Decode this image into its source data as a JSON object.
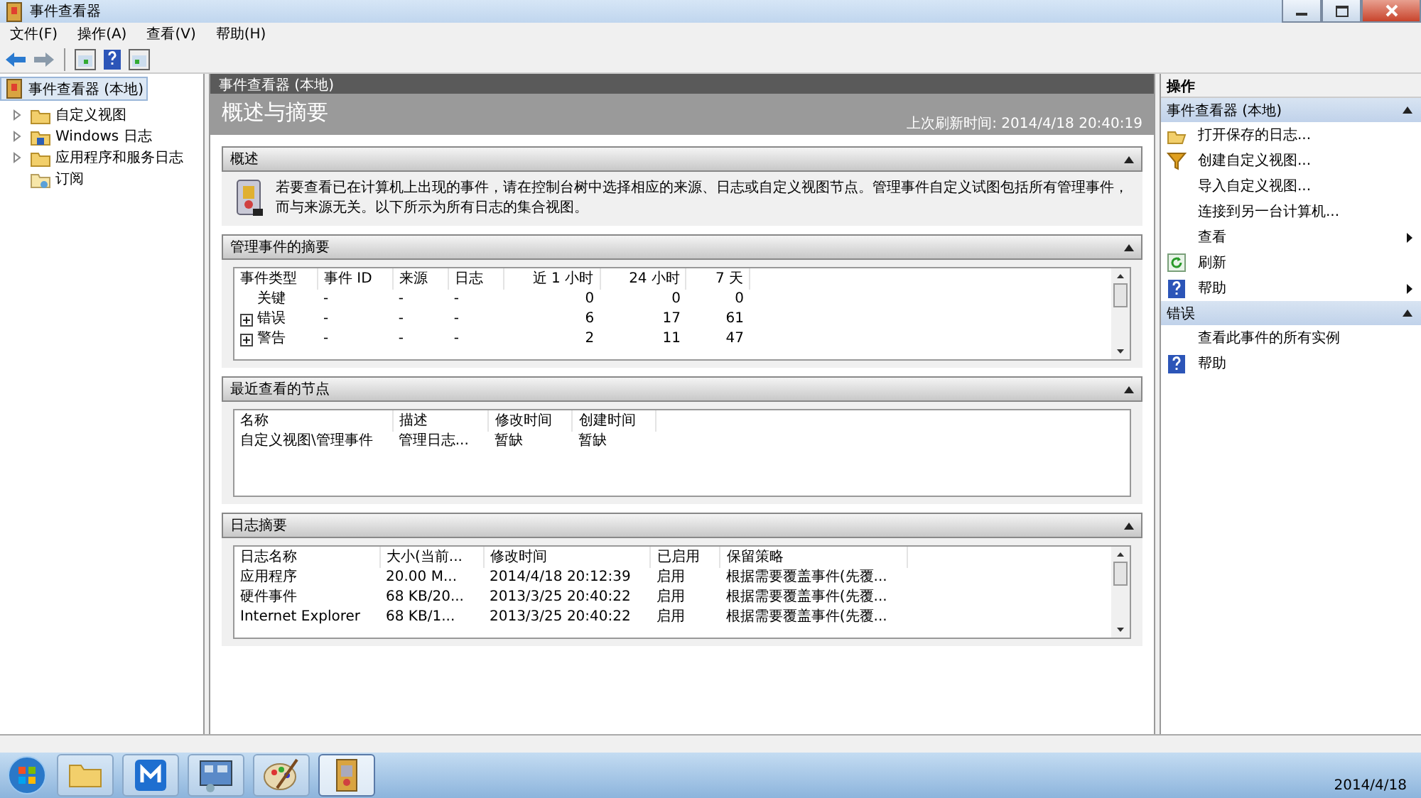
{
  "window": {
    "title": "事件查看器"
  },
  "menu": [
    {
      "label": "文件(F)"
    },
    {
      "label": "操作(A)"
    },
    {
      "label": "查看(V)"
    },
    {
      "label": "帮助(H)"
    }
  ],
  "tree": {
    "label": "事件查看器 (本地)",
    "selected": true,
    "children": [
      {
        "label": "自定义视图",
        "expanded": false,
        "kind": "folder"
      },
      {
        "label": "Windows 日志",
        "expanded": false,
        "kind": "logs"
      },
      {
        "label": "应用程序和服务日志",
        "expanded": false,
        "kind": "folder"
      },
      {
        "label": "订阅",
        "kind": "subscription"
      }
    ]
  },
  "center": {
    "header": "事件查看器 (本地)",
    "title": "概述与摘要",
    "refresh_time": "上次刷新时间: 2014/4/18 20:40:19",
    "sections": [
      {
        "title": "概述",
        "expanded": true,
        "kind": "text",
        "text": "若要查看已在计算机上出现的事件，请在控制台树中选择相应的来源、日志或自定义视图节点。管理事件自定义试图包括所有管理事件，而与来源无关。以下所示为所有日志的集合视图。"
      },
      {
        "title": "管理事件的摘要",
        "expanded": true,
        "kind": "table",
        "scroll": true,
        "columns": [
          {
            "label": "事件类型",
            "kind": "text"
          },
          {
            "label": "事件 ID",
            "kind": "text"
          },
          {
            "label": "来源",
            "kind": "text"
          },
          {
            "label": "日志",
            "kind": "text"
          },
          {
            "label": "近 1 小时",
            "kind": "number"
          },
          {
            "label": "24 小时",
            "kind": "number"
          },
          {
            "label": "7 天",
            "kind": "number"
          }
        ],
        "rows": [
          {
            "expandable": false,
            "cells": [
              "关键",
              "-",
              "-",
              "-",
              "0",
              "0",
              "0"
            ]
          },
          {
            "expandable": true,
            "cells": [
              "错误",
              "-",
              "-",
              "-",
              "6",
              "17",
              "61"
            ]
          },
          {
            "expandable": true,
            "cells": [
              "警告",
              "-",
              "-",
              "-",
              "2",
              "11",
              "47"
            ]
          }
        ]
      },
      {
        "title": "最近查看的节点",
        "expanded": true,
        "kind": "table",
        "scroll": false,
        "columns": [
          {
            "label": "名称",
            "kind": "text"
          },
          {
            "label": "描述",
            "kind": "text"
          },
          {
            "label": "修改时间",
            "kind": "text"
          },
          {
            "label": "创建时间",
            "kind": "text"
          }
        ],
        "rows": [
          {
            "cells": [
              "自定义视图\\管理事件",
              "管理日志...",
              "暂缺",
              "暂缺"
            ]
          }
        ]
      },
      {
        "title": "日志摘要",
        "expanded": true,
        "kind": "table",
        "scroll": true,
        "columns": [
          {
            "label": "日志名称",
            "kind": "text"
          },
          {
            "label": "大小(当前...",
            "kind": "text"
          },
          {
            "label": "修改时间",
            "kind": "text"
          },
          {
            "label": "已启用",
            "kind": "text"
          },
          {
            "label": "保留策略",
            "kind": "text"
          }
        ],
        "rows": [
          {
            "cells": [
              "应用程序",
              "20.00 M...",
              "2014/4/18 20:12:39",
              "启用",
              "根据需要覆盖事件(先覆..."
            ]
          },
          {
            "cells": [
              "硬件事件",
              "68 KB/20...",
              "2013/3/25 20:40:22",
              "启用",
              "根据需要覆盖事件(先覆..."
            ]
          },
          {
            "cells": [
              "Internet Explorer",
              "68 KB/1...",
              "2013/3/25 20:40:22",
              "启用",
              "根据需要覆盖事件(先覆..."
            ]
          }
        ]
      }
    ]
  },
  "actions": {
    "title": "操作",
    "groups": [
      {
        "title": "事件查看器 (本地)",
        "expanded": true,
        "items": [
          {
            "label": "打开保存的日志...",
            "kind": "open",
            "submenu": false
          },
          {
            "label": "创建自定义视图...",
            "kind": "filter",
            "submenu": false
          },
          {
            "label": "导入自定义视图...",
            "kind": "plain",
            "submenu": false
          },
          {
            "label": "连接到另一台计算机...",
            "kind": "plain",
            "submenu": false
          },
          {
            "label": "查看",
            "kind": "plain",
            "submenu": true
          },
          {
            "label": "刷新",
            "kind": "refresh",
            "submenu": false
          },
          {
            "label": "帮助",
            "kind": "help",
            "submenu": true
          }
        ]
      },
      {
        "title": "错误",
        "expanded": true,
        "items": [
          {
            "label": "查看此事件的所有实例",
            "kind": "plain",
            "submenu": false
          },
          {
            "label": "帮助",
            "kind": "help",
            "submenu": false
          }
        ]
      }
    ]
  },
  "taskbar": {
    "apps": [
      {
        "kind": "folder",
        "selected": false
      },
      {
        "kind": "browser",
        "selected": false
      },
      {
        "kind": "control",
        "selected": false
      },
      {
        "kind": "paint",
        "selected": false
      },
      {
        "kind": "viewer",
        "selected": true
      }
    ],
    "date": "2014/4/18"
  }
}
